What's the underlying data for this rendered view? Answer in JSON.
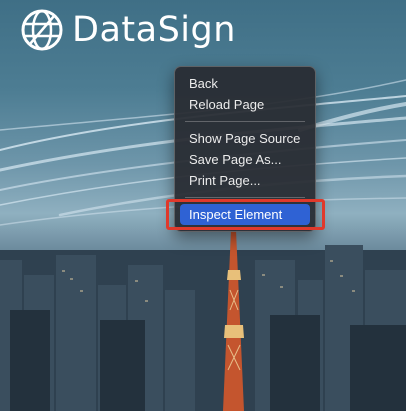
{
  "brand": {
    "name": "DataSign"
  },
  "context_menu": {
    "items": [
      {
        "label": "Back"
      },
      {
        "label": "Reload Page"
      },
      {
        "label": "Show Page Source"
      },
      {
        "label": "Save Page As..."
      },
      {
        "label": "Print Page..."
      },
      {
        "label": "Inspect Element"
      }
    ]
  },
  "colors": {
    "menu_bg": "#2a2e34",
    "selected": "#2f62d4",
    "highlight": "#e0392b",
    "text": "#ececec"
  }
}
